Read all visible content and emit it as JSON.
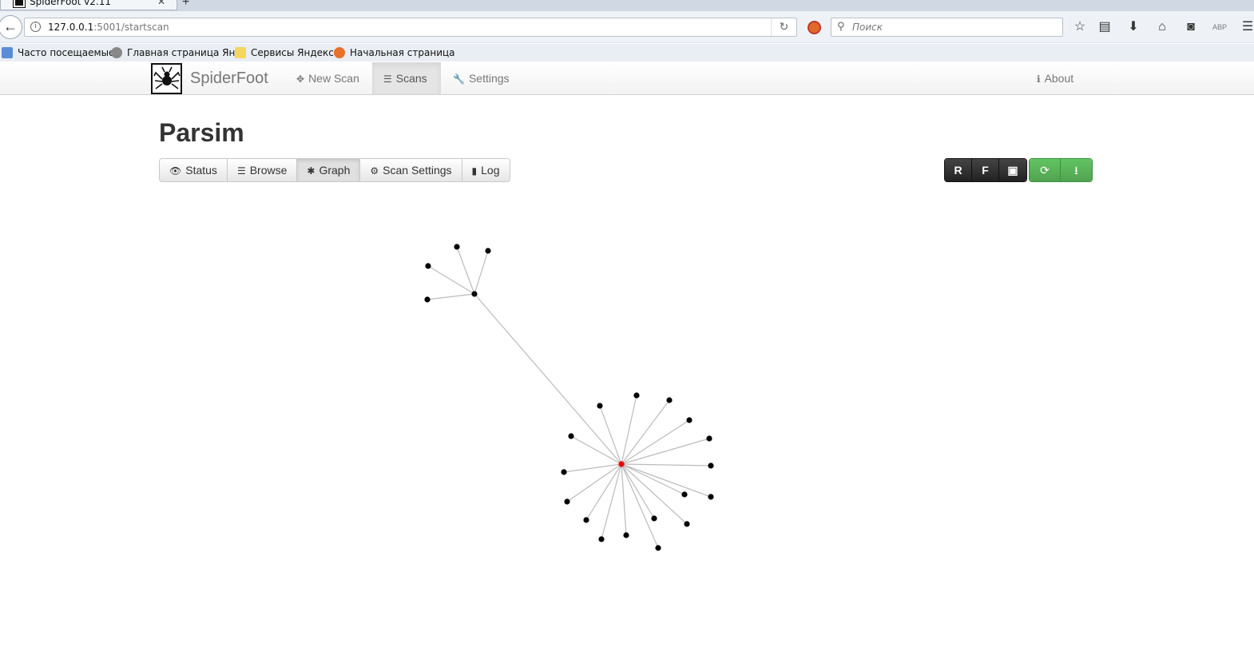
{
  "browser": {
    "tab_title": "SpiderFoot v2.11",
    "url_host": "127.0.0.1",
    "url_path": ":5001/startscan",
    "search_placeholder": "Поиск",
    "bookmarks": [
      {
        "label": "Часто посещаемые",
        "icon": "folder-icon"
      },
      {
        "label": "Главная страница Ян...",
        "icon": "globe-icon"
      },
      {
        "label": "Сервисы Яндекса",
        "icon": "folder-icon"
      },
      {
        "label": "Начальная страница",
        "icon": "firefox-icon"
      }
    ]
  },
  "app": {
    "brand": "SpiderFoot",
    "nav": {
      "new_scan": "New Scan",
      "scans": "Scans",
      "settings": "Settings",
      "about": "About"
    }
  },
  "scan": {
    "title": "Parsim",
    "tabs": {
      "status": "Status",
      "browse": "Browse",
      "graph": "Graph",
      "scan_settings": "Scan Settings",
      "log": "Log"
    },
    "active_tab": "Graph",
    "actions": {
      "r": "R",
      "f": "F"
    }
  },
  "graph": {
    "root_color": "#ee0000",
    "node_color": "#000000",
    "edge_color": "#bbbbbb",
    "root_node_count": 1,
    "hub_node_count": 1,
    "hub_child_count": 4,
    "root_leaf_count": 19
  }
}
